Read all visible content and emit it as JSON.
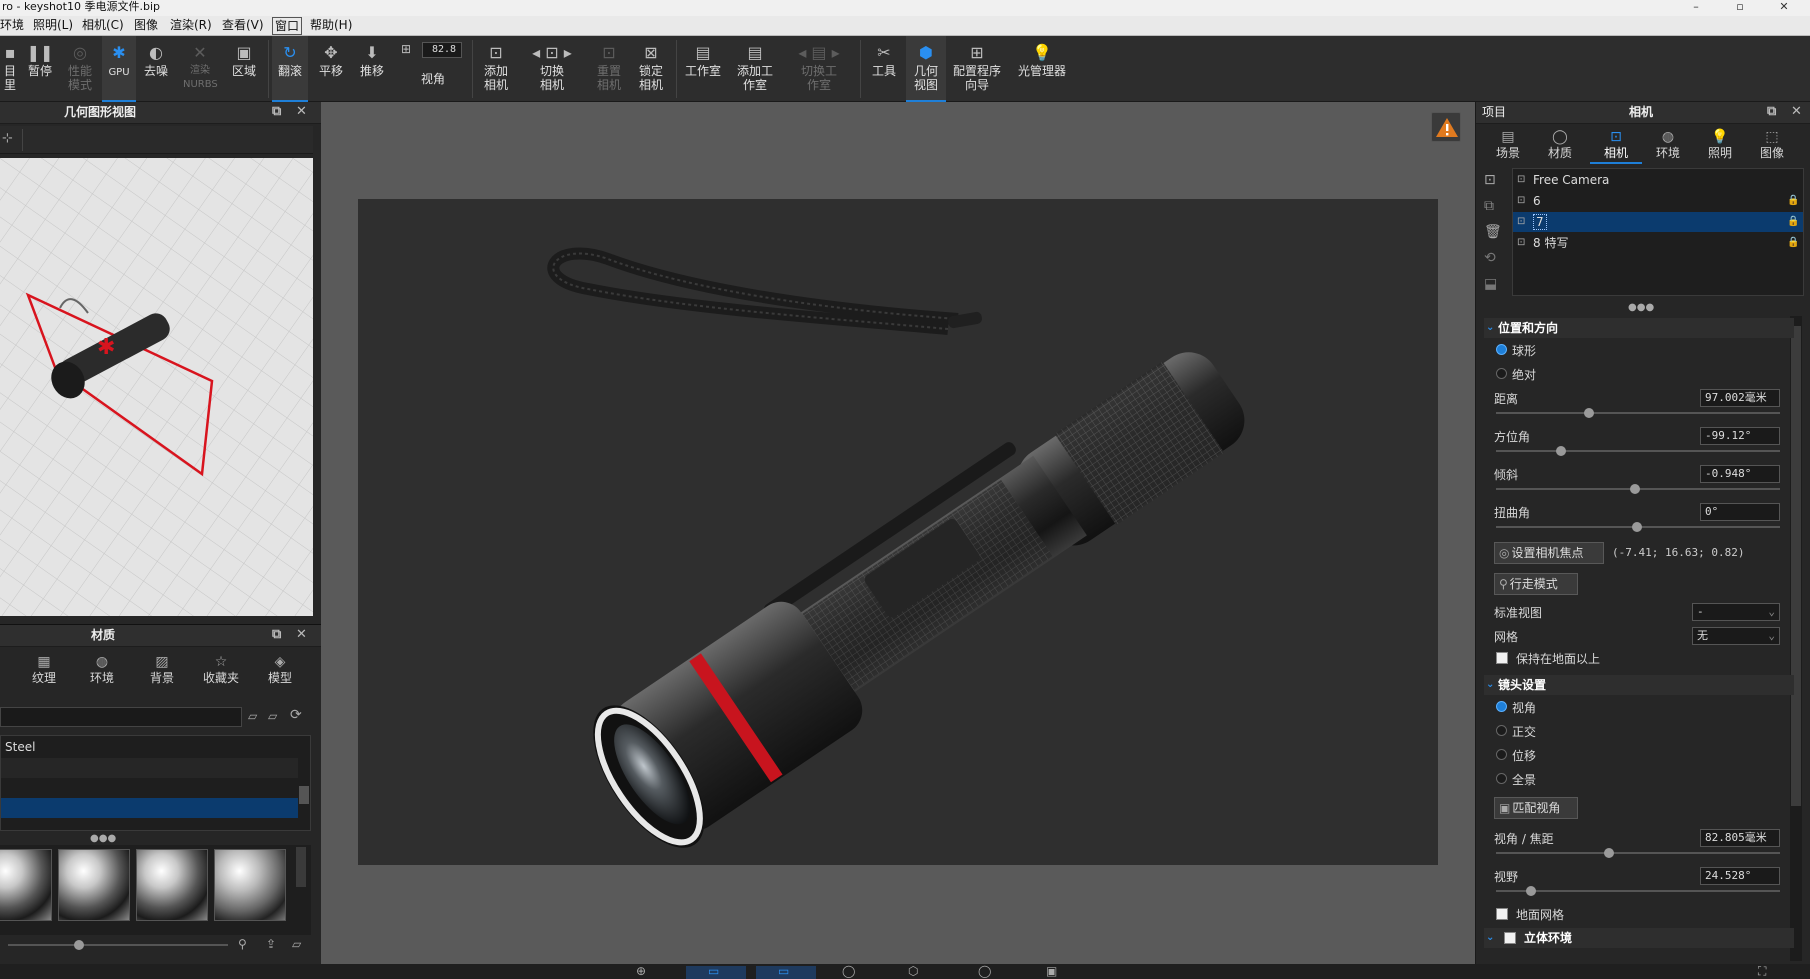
{
  "title_bar": {
    "text": "ro  - keyshot10 季电源文件.bip"
  },
  "menu": [
    {
      "label": "环境"
    },
    {
      "label": "照明(L)"
    },
    {
      "label": "相机(C)"
    },
    {
      "label": "图像"
    },
    {
      "label": "渲染(R)"
    },
    {
      "label": "查看(V)"
    },
    {
      "label": "窗口"
    },
    {
      "label": "帮助(H)"
    }
  ],
  "toolbar": {
    "items": [
      {
        "label": "目里",
        "icon": "import-icon"
      },
      {
        "label": "暂停",
        "icon": "pause-icon"
      },
      {
        "label": "性能模式",
        "icon": "performance-icon"
      },
      {
        "label": "GPU",
        "icon": "gpu-icon"
      },
      {
        "label": "去噪",
        "icon": "denoise-icon"
      },
      {
        "label": "渲染NURBS",
        "icon": "nurbs-icon"
      },
      {
        "label": "区域",
        "icon": "region-icon"
      },
      {
        "label": "翻滚",
        "icon": "tumble-icon"
      },
      {
        "label": "平移",
        "icon": "pan-icon"
      },
      {
        "label": "推移",
        "icon": "dolly-icon"
      },
      {
        "label": "视角",
        "icon": "fov-icon"
      },
      {
        "label": "添加相机",
        "icon": "add-camera-icon"
      },
      {
        "label": "切换相机",
        "icon": "switch-camera-icon"
      },
      {
        "label": "重置相机",
        "icon": "reset-camera-icon"
      },
      {
        "label": "锁定相机",
        "icon": "lock-camera-icon"
      },
      {
        "label": "工作室",
        "icon": "studio-icon"
      },
      {
        "label": "添加工作室",
        "icon": "add-studio-icon"
      },
      {
        "label": "切换工作室",
        "icon": "switch-studio-icon"
      },
      {
        "label": "工具",
        "icon": "tools-icon"
      },
      {
        "label": "几何视图",
        "icon": "geometry-view-icon"
      },
      {
        "label": "配置程序向导",
        "icon": "configurator-icon"
      },
      {
        "label": "光管理器",
        "icon": "light-manager-icon"
      }
    ],
    "fov_value": "82.8"
  },
  "geometry_panel": {
    "title": "几何图形视图"
  },
  "material_panel": {
    "title": "材质",
    "tabs": [
      {
        "label": "纹理",
        "icon": "texture-icon"
      },
      {
        "label": "环境",
        "icon": "environment-icon"
      },
      {
        "label": "背景",
        "icon": "background-icon"
      },
      {
        "label": "收藏夹",
        "icon": "favorites-icon"
      },
      {
        "label": "模型",
        "icon": "model-icon"
      }
    ],
    "list_item": "Steel"
  },
  "right_panel": {
    "project_label": "项目",
    "title": "相机",
    "tabs": [
      {
        "label": "场景",
        "icon": "scene-icon"
      },
      {
        "label": "材质",
        "icon": "material-icon"
      },
      {
        "label": "相机",
        "icon": "camera-icon"
      },
      {
        "label": "环境",
        "icon": "environment-icon"
      },
      {
        "label": "照明",
        "icon": "lighting-icon"
      },
      {
        "label": "图像",
        "icon": "image-icon"
      }
    ],
    "cameras": [
      {
        "name": "Free Camera"
      },
      {
        "name": "6"
      },
      {
        "name": "7"
      },
      {
        "name": "8 特写"
      }
    ],
    "position_section": {
      "title": "位置和方向",
      "mode_spherical": "球形",
      "mode_absolute": "绝对",
      "distance_label": "距离",
      "distance_value": "97.002毫米",
      "azimuth_label": "方位角",
      "azimuth_value": "-99.12°",
      "inclination_label": "倾斜",
      "inclination_value": "-0.948°",
      "twist_label": "扭曲角",
      "twist_value": "0°",
      "set_focus_button": "设置相机焦点",
      "focus_coords": "(-7.41; 16.63; 0.82)",
      "walk_mode_button": "行走模式",
      "standard_view_label": "标准视图",
      "standard_view_value": "-",
      "grid_label": "网格",
      "grid_value": "无",
      "keep_above_ground": "保持在地面以上"
    },
    "lens_section": {
      "title": "镜头设置",
      "mode_perspective": "视角",
      "mode_orthographic": "正交",
      "mode_shift": "位移",
      "mode_panoramic": "全景",
      "match_perspective_button": "匹配视角",
      "focal_label": "视角 / 焦距",
      "focal_value": "82.805毫米",
      "fov_label": "视野",
      "fov_value": "24.528°",
      "ground_grid": "地面网格"
    },
    "stereo_section": {
      "title": "立体环境"
    }
  },
  "colors": {
    "accent": "#1e7fd8",
    "selection": "#0b3b6e",
    "warning": "#e07a1f",
    "ring_red": "#c8141e"
  }
}
